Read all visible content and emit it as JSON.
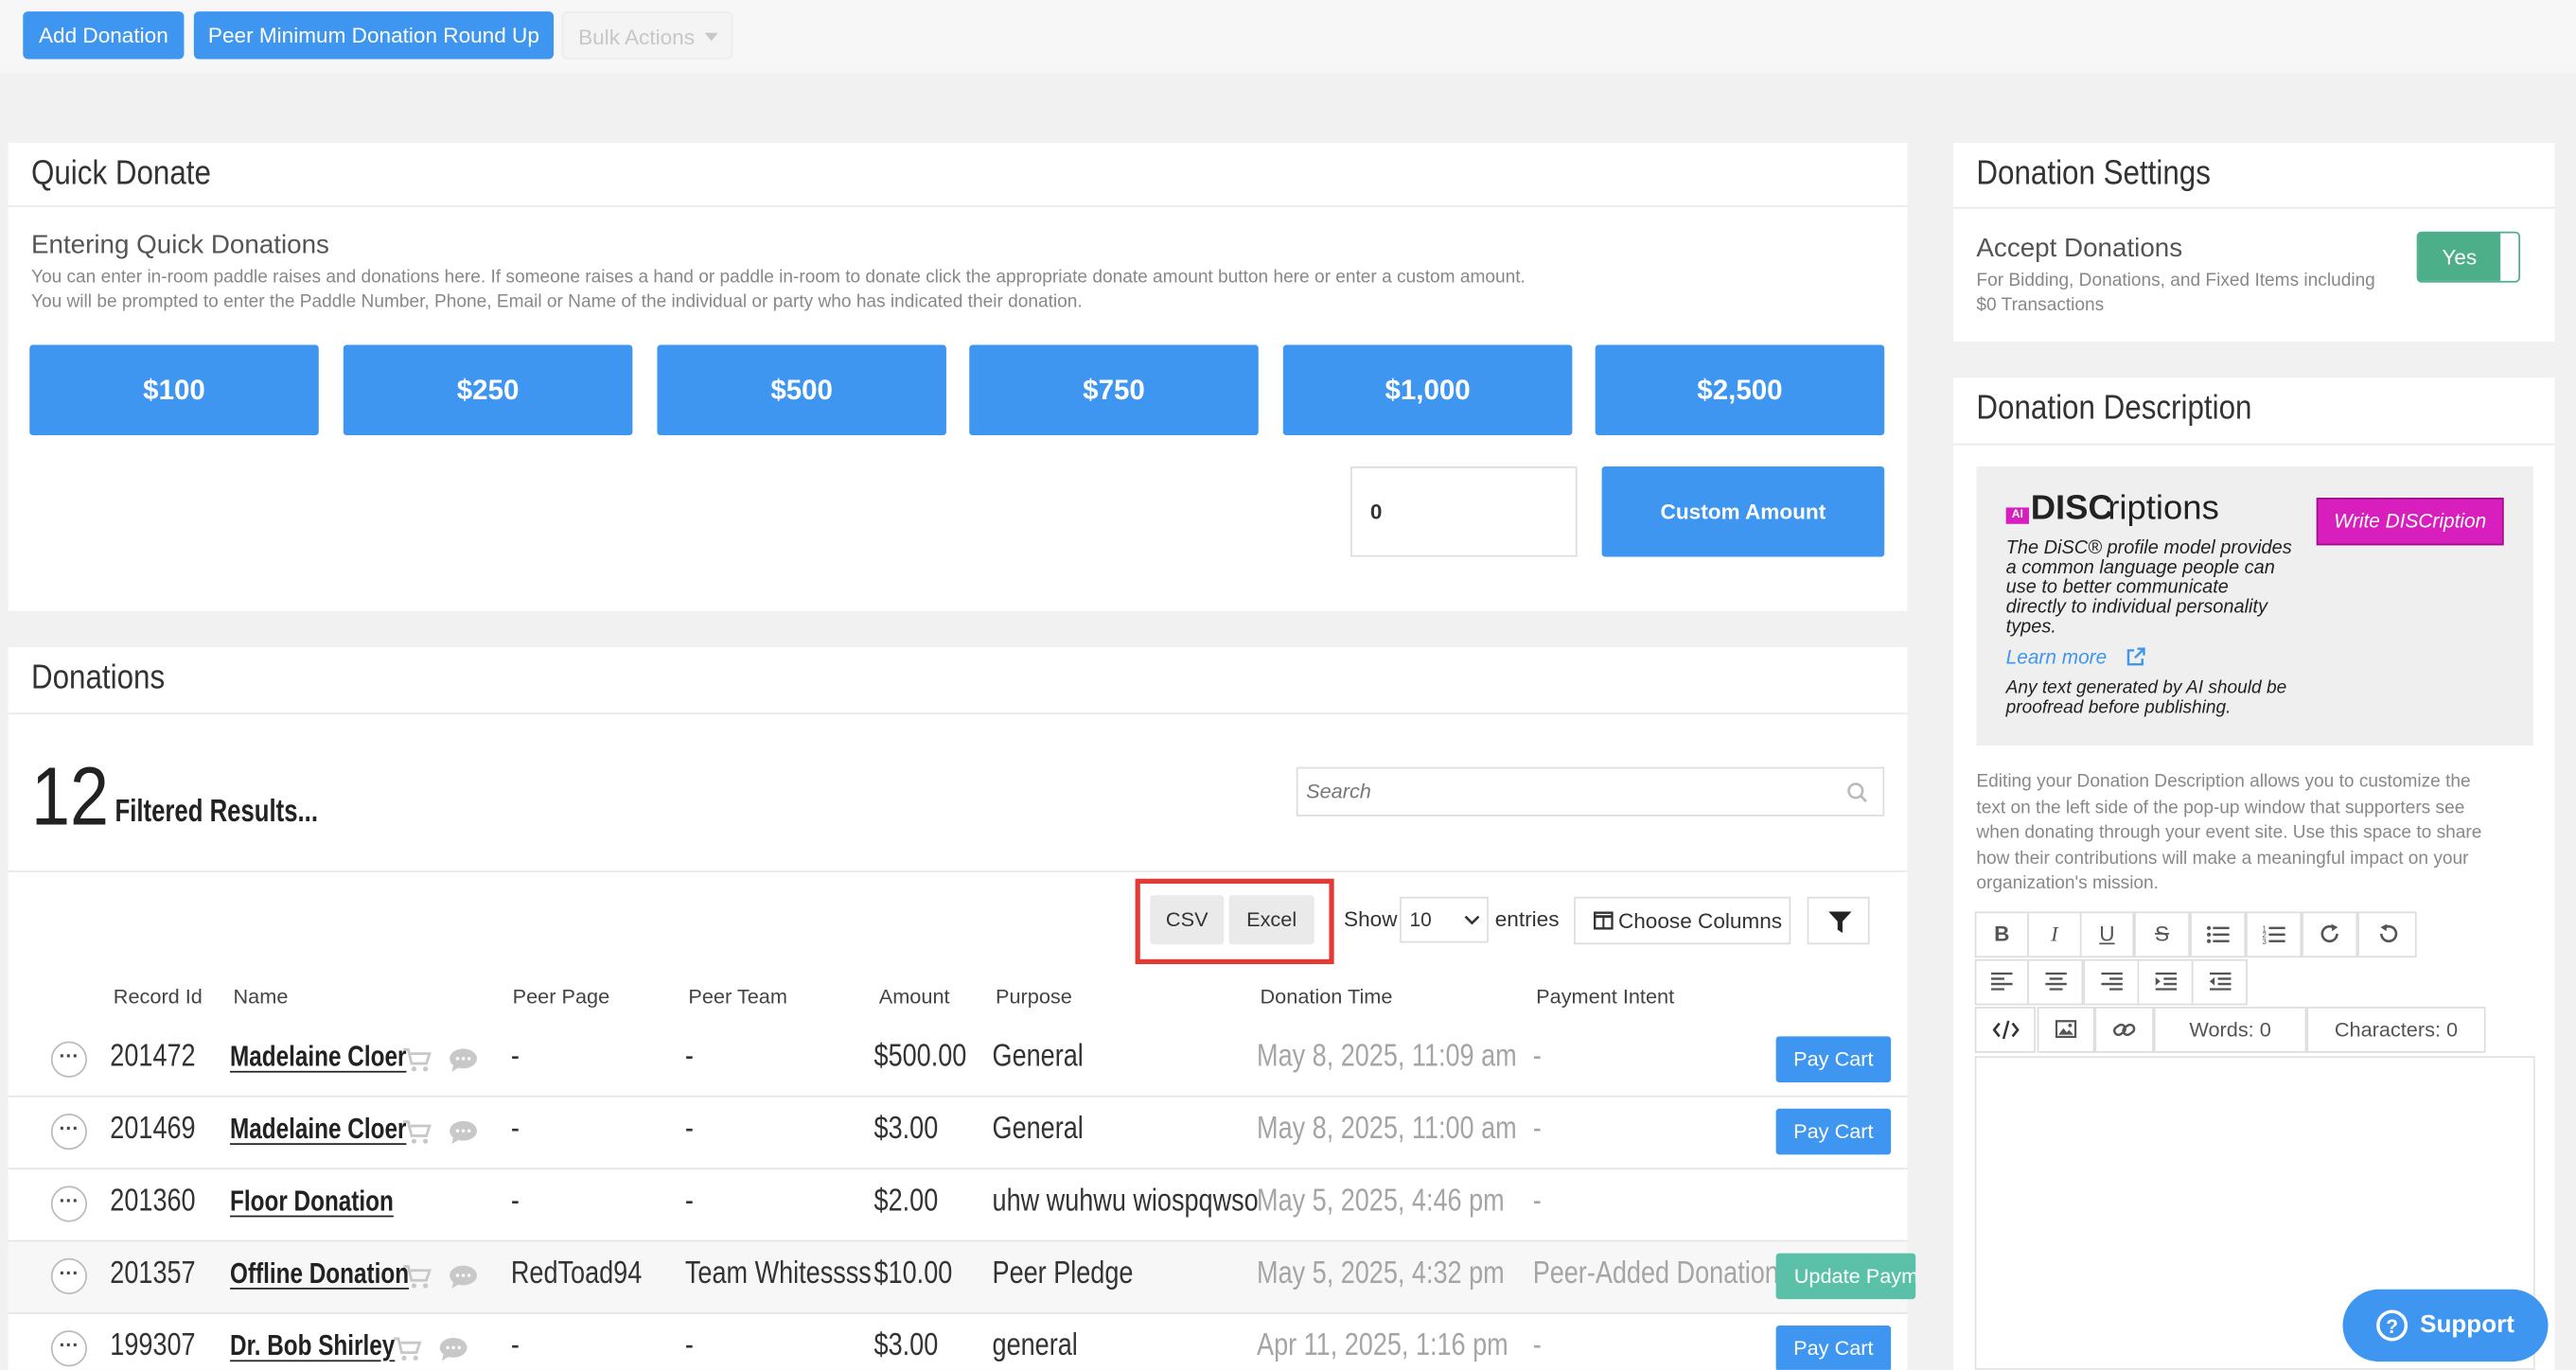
{
  "toolbar": {
    "add_donation": "Add Donation",
    "peer_min": "Peer Minimum Donation Round Up",
    "bulk_actions": "Bulk Actions"
  },
  "quick_donate": {
    "title": "Quick Donate",
    "subtitle": "Entering Quick Donations",
    "desc1": "You can enter in-room paddle raises and donations here. If someone raises a hand or paddle in-room to donate click the appropriate donate amount button here or enter a custom amount.",
    "desc2": "You will be prompted to enter the Paddle Number, Phone, Email or Name of the individual or party who has indicated their donation.",
    "amounts": [
      "$100",
      "$250",
      "$500",
      "$750",
      "$1,000",
      "$2,500"
    ],
    "custom_value": "0",
    "custom_button": "Custom Amount"
  },
  "donations": {
    "title": "Donations",
    "count": "12",
    "filtered_label": "Filtered Results...",
    "search_placeholder": "Search",
    "csv": "CSV",
    "excel": "Excel",
    "show": "Show",
    "show_value": "10",
    "entries": "entries",
    "choose_columns": "Choose Columns",
    "highlight_color": "#e53935",
    "columns": [
      "Record Id",
      "Name",
      "Peer Page",
      "Peer Team",
      "Amount",
      "Purpose",
      "Donation Time",
      "Payment Intent"
    ],
    "rows": [
      {
        "id": "201472",
        "name": "Madelaine Cloer",
        "peer_page": "-",
        "peer_team": "-",
        "amount": "$500.00",
        "purpose": "General",
        "time": "May 8, 2025, 11:09 am",
        "intent": "-",
        "action": "Pay Cart",
        "icons": true
      },
      {
        "id": "201469",
        "name": "Madelaine Cloer",
        "peer_page": "-",
        "peer_team": "-",
        "amount": "$3.00",
        "purpose": "General",
        "time": "May 8, 2025, 11:00 am",
        "intent": "-",
        "action": "Pay Cart",
        "icons": true
      },
      {
        "id": "201360",
        "name": "Floor Donation",
        "peer_page": "-",
        "peer_team": "-",
        "amount": "$2.00",
        "purpose": "uhw wuhwu wiospqwso",
        "time": "May 5, 2025, 4:46 pm",
        "intent": "-",
        "action": "",
        "icons": false
      },
      {
        "id": "201357",
        "name": "Offline Donation",
        "peer_page": "RedToad94",
        "peer_team": "Team Whitessss",
        "amount": "$10.00",
        "purpose": "Peer Pledge",
        "time": "May 5, 2025, 4:32 pm",
        "intent": "Peer-Added Donation",
        "action": "Update Paym",
        "icons": true
      },
      {
        "id": "199307",
        "name": "Dr. Bob Shirley",
        "peer_page": "-",
        "peer_team": "-",
        "amount": "$3.00",
        "purpose": "general",
        "time": "Apr 11, 2025, 1:16 pm",
        "intent": "-",
        "action": "Pay Cart",
        "icons": true
      }
    ]
  },
  "settings": {
    "title": "Donation Settings",
    "accept_label": "Accept Donations",
    "accept_desc1": "For Bidding, Donations, and Fixed Items including",
    "accept_desc2": "$0 Transactions",
    "toggle": "Yes"
  },
  "description": {
    "title": "Donation Description",
    "ai_badge": "AI",
    "brand_bold": "DISC",
    "brand_rest": "riptions",
    "write_button": "Write DISCription",
    "promo_lines": [
      "The DiSC® profile model provides",
      "a common language people can",
      "use to better communicate",
      "directly to individual personality",
      "types."
    ],
    "learn_more": "Learn more",
    "note_lines": [
      "Any text generated by AI should be",
      "proofread before publishing."
    ],
    "help_lines": [
      "Editing your Donation Description allows you to customize the",
      "text on the left side of the pop-up window that supporters see",
      "when donating through your event site. Use this space to share",
      "how their contributions will make a meaningful impact on your",
      "organization's mission."
    ],
    "words": "Words: 0",
    "characters": "Characters: 0"
  },
  "support": "Support",
  "colors": {
    "primary": "#3e96f0",
    "toggle": "#4caf8a",
    "magenta": "#d81fbe",
    "teal": "#5bc0a8"
  }
}
